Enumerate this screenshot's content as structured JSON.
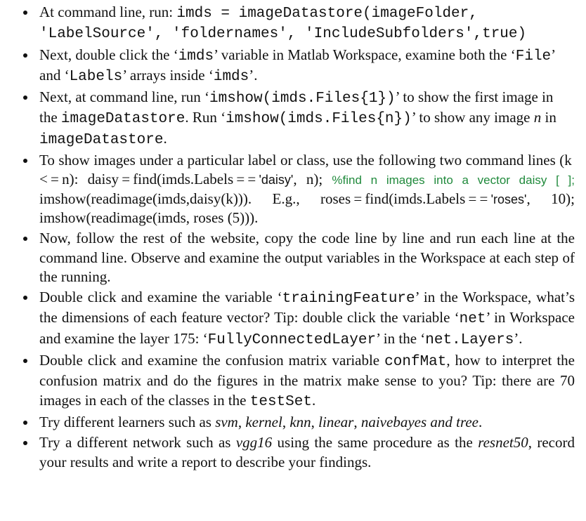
{
  "li1": {
    "t0": "At command line, run: ",
    "c1": "imds = imageDatastore(imageFolder, 'LabelSource', 'foldernames', 'IncludeSubfolders',true)"
  },
  "li2": {
    "t0": "Next, double click the ‘",
    "c1": "imds",
    "t1": "’ variable in Matlab Workspace, examine both the ‘",
    "c2": "File",
    "t2": "’ and ‘",
    "c3": "Labels",
    "t3": "’ arrays inside ‘",
    "c4": "imds",
    "t4": "’."
  },
  "li3": {
    "t0": "Next, at command line, run ‘",
    "c1": "imshow(imds.Files{1})",
    "t1": "’ to show the first image in the ",
    "c2": "imageDatastore",
    "t2": ". Run ‘",
    "c3": "imshow(imds.Files{n})",
    "t3": "’ to show any image ",
    "e4": "n",
    "t4": " in ",
    "c5": "imageDatastore",
    "t5": "."
  },
  "li4": {
    "t0": "To show images under a particular label or class, use the following two command lines (k < = n): daisy = find(imds.Labels = = ",
    "s1": "'daisy'",
    "t1": ", n); ",
    "m2": "%find n images into a vector daisy [ ];",
    "t3": " imshow(readimage(imds,daisy(k))). E.g., roses = find(imds.Labels = = ",
    "s4": "'roses'",
    "t4": ", 10); imshow(readimage(imds, roses (5)))."
  },
  "li5": {
    "t0": "Now, follow the rest of the website, copy the code line by line and run each line at the command line. Observe and examine the output variables in the Workspace at each step of the running."
  },
  "li6": {
    "t0": "Double click and examine the variable ‘",
    "c1": "trainingFeature",
    "t1": "’ in the Workspace, what’s the dimensions of each feature vector? Tip: double click the variable ‘",
    "c2": "net",
    "t2": "’ in Workspace and examine the layer 175: ‘",
    "c3": "FullyConnectedLayer",
    "t3": "’ in the ‘",
    "c4": "net.Layers",
    "t4": "’."
  },
  "li7": {
    "t0": "Double click and examine the confusion matrix variable ",
    "c1": "confMat",
    "t1": ", how to interpret the confusion matrix and do the figures in the matrix make sense to you? Tip: there are 70 images in each of the classes in the ",
    "c2": "testSet",
    "t2": "."
  },
  "li8": {
    "t0": "Try different learners such as ",
    "e1": "svm",
    "t1": ", ",
    "e2": "kernel",
    "t2": ", ",
    "e3": "knn",
    "t3": ", ",
    "e4": "linear",
    "t4": ", ",
    "e5": "naivebayes and tree",
    "t5": "."
  },
  "li9": {
    "t0": "Try a different network such as ",
    "e1": "vgg16",
    "t1": " using the same procedure as the ",
    "e2": "resnet50",
    "t2": ", record your results and write a report to describe your findings."
  }
}
